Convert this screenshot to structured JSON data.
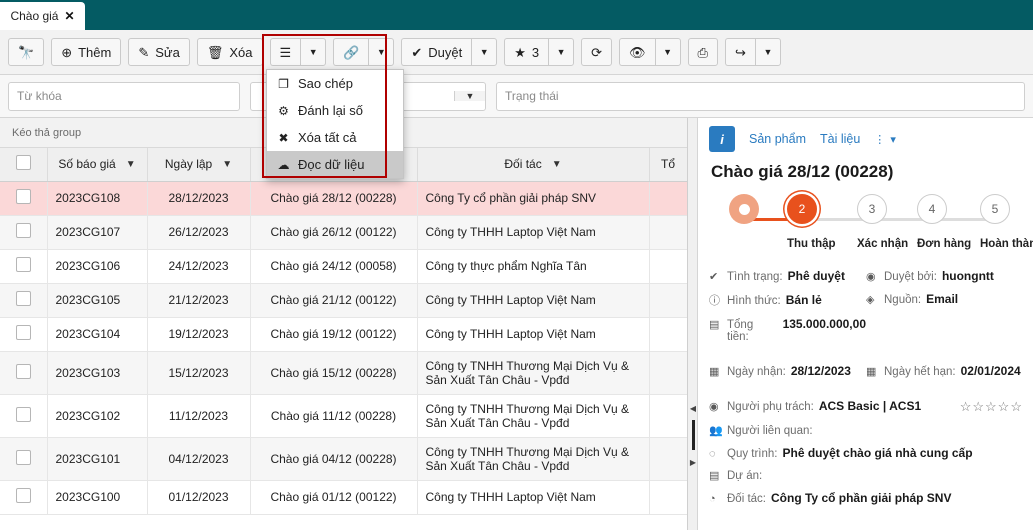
{
  "window": {
    "tab_label": "Chào giá",
    "tab_close": "✕",
    "header_color": "#045b63"
  },
  "toolbar": {
    "search_icon": "binoculars-icon",
    "add_label": "Thêm",
    "edit_label": "Sửa",
    "delete_label": "Xóa",
    "menu_icon": "hamburger-icon",
    "link_icon": "link-icon",
    "approve_label": "Duyệt",
    "star_count": "3",
    "refresh_icon": "refresh-icon",
    "eye_icon": "eye-icon",
    "print_icon": "printer-icon",
    "share_icon": "share-icon",
    "caret": "▼"
  },
  "dropdown_menu": {
    "items": [
      {
        "label": "Sao chép",
        "icon": "copy-icon",
        "glyph": "❐",
        "active": false
      },
      {
        "label": "Đánh lại số",
        "icon": "gears-icon",
        "glyph": "⚙",
        "active": false
      },
      {
        "label": "Xóa tất cả",
        "icon": "delete-circle-icon",
        "glyph": "✖",
        "active": false
      },
      {
        "label": "Đọc dữ liệu",
        "icon": "cloud-upload-icon",
        "glyph": "☁",
        "active": true
      }
    ]
  },
  "filters": {
    "keyword_placeholder": "Từ khóa",
    "second_placeholder": "",
    "second_caret": "▼",
    "status_placeholder": "Trạng thái"
  },
  "grid": {
    "group_hint": "Kéo thả group",
    "columns": [
      {
        "key": "check",
        "label": "",
        "filter": false
      },
      {
        "key": "code",
        "label": "Số báo giá",
        "filter": true
      },
      {
        "key": "date",
        "label": "Ngày lập",
        "filter": true
      },
      {
        "key": "name",
        "label": "",
        "filter": false
      },
      {
        "key": "partner",
        "label": "Đối tác",
        "filter": true
      },
      {
        "key": "total",
        "label": "Tổ",
        "filter": false
      }
    ],
    "rows": [
      {
        "code": "2023CG108",
        "date": "28/12/2023",
        "name": "Chào giá 28/12 (00228)",
        "partner": "Công Ty cổ phần giải pháp SNV",
        "selected": true
      },
      {
        "code": "2023CG107",
        "date": "26/12/2023",
        "name": "Chào giá 26/12 (00122)",
        "partner": "Công ty THHH Laptop Việt Nam",
        "selected": false
      },
      {
        "code": "2023CG106",
        "date": "24/12/2023",
        "name": "Chào giá 24/12 (00058)",
        "partner": "Công ty thực phẩm Nghĩa Tân",
        "selected": false
      },
      {
        "code": "2023CG105",
        "date": "21/12/2023",
        "name": "Chào giá 21/12 (00122)",
        "partner": "Công ty THHH Laptop Việt Nam",
        "selected": false
      },
      {
        "code": "2023CG104",
        "date": "19/12/2023",
        "name": "Chào giá 19/12 (00122)",
        "partner": "Công ty THHH Laptop Việt Nam",
        "selected": false
      },
      {
        "code": "2023CG103",
        "date": "15/12/2023",
        "name": "Chào giá 15/12 (00228)",
        "partner": "Công ty TNHH Thương Mại Dịch Vụ & Sản Xuất Tân Châu - Vpđd",
        "selected": false
      },
      {
        "code": "2023CG102",
        "date": "11/12/2023",
        "name": "Chào giá 11/12 (00228)",
        "partner": "Công ty TNHH Thương Mại Dịch Vụ & Sản Xuất Tân Châu - Vpđd",
        "selected": false
      },
      {
        "code": "2023CG101",
        "date": "04/12/2023",
        "name": "Chào giá 04/12 (00228)",
        "partner": "Công ty TNHH Thương Mại Dịch Vụ & Sản Xuất Tân Châu - Vpđd",
        "selected": false
      },
      {
        "code": "2023CG100",
        "date": "01/12/2023",
        "name": "Chào giá 01/12 (00122)",
        "partner": "Công ty THHH Laptop Việt Nam",
        "selected": false
      }
    ]
  },
  "detail": {
    "tabs": {
      "info_icon": "i",
      "product": "Sản phẩm",
      "document": "Tài liệu",
      "more": "⋮ ▾"
    },
    "title": "Chào giá 28/12 (00228)",
    "stepper": {
      "nodes": [
        {
          "num": "",
          "label": "",
          "state": "start"
        },
        {
          "num": "2",
          "label": "Thu thập",
          "state": "current"
        },
        {
          "num": "3",
          "label": "Xác nhận",
          "state": "todo"
        },
        {
          "num": "4",
          "label": "Đơn hàng",
          "state": "todo"
        },
        {
          "num": "5",
          "label": "Hoàn thành",
          "state": "todo"
        }
      ],
      "accent": "#e8511d"
    },
    "fields": {
      "status_label": "Tình trạng:",
      "status_value": "Phê duyệt",
      "approver_label": "Duyệt bởi:",
      "approver_value": "huongntt",
      "type_label": "Hình thức:",
      "type_value": "Bán lẻ",
      "source_label": "Nguồn:",
      "source_value": "Email",
      "total_label": "Tổng tiền:",
      "total_value": "135.000.000,00",
      "recv_label": "Ngày nhận:",
      "recv_value": "28/12/2023",
      "exp_label": "Ngày hết hạn:",
      "exp_value": "02/01/2024",
      "owner_label": "Người phụ trách:",
      "owner_value": "ACS Basic | ACS1",
      "related_label": "Người liên quan:",
      "related_value": "",
      "process_label": "Quy trình:",
      "process_value": "Phê duyệt chào giá nhà cung cấp",
      "project_label": "Dự án:",
      "project_value": "",
      "partner_label": "Đối tác:",
      "partner_value": "Công Ty cổ phần giải pháp SNV",
      "rating": "☆☆☆☆☆"
    }
  }
}
